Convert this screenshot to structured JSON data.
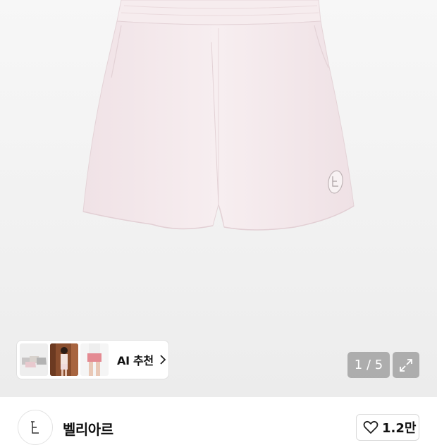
{
  "gallery": {
    "image_alt": "light pink sweat shorts product photo",
    "page_current": "1",
    "page_total": "5",
    "page_indicator": "1 / 5"
  },
  "ai_recommend": {
    "label": "AI 추천",
    "thumbnails": [
      "thumbnail-shorts-colors",
      "thumbnail-model-doorway",
      "thumbnail-model-pink-shorts"
    ]
  },
  "brand": {
    "name": "벨리아르",
    "likes": "1.2만"
  },
  "colors": {
    "shorts": "#f5e9ec",
    "overlay": "rgba(120,120,120,0.55)"
  }
}
